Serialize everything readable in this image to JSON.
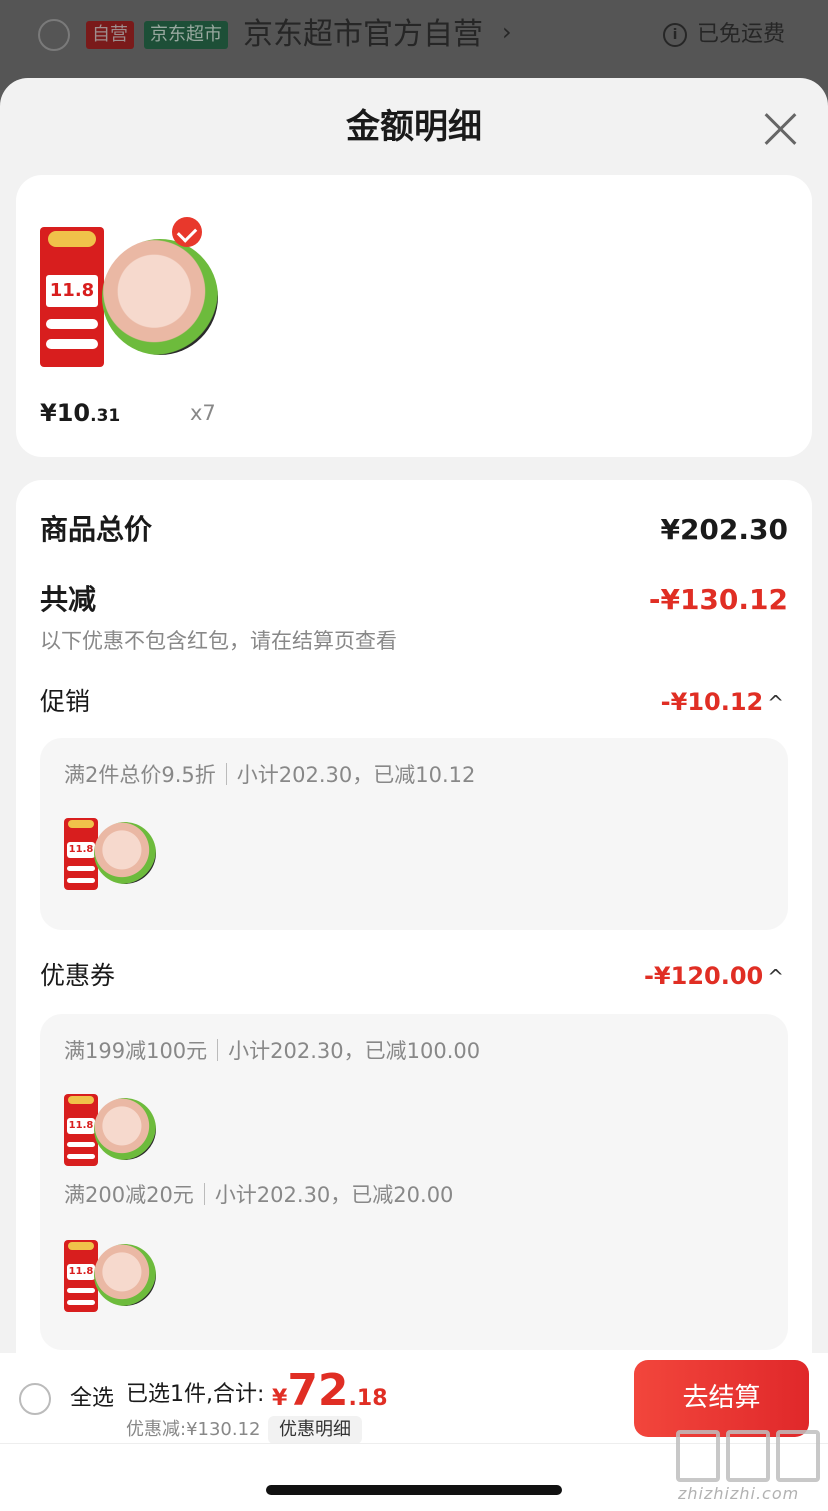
{
  "background_header": {
    "badge_self": "自营",
    "badge_mart": "京东超市",
    "store_name": "京东超市官方自营",
    "chevron": "›",
    "info_icon": "i",
    "shipping": "已免运费"
  },
  "sheet": {
    "title": "金额明细"
  },
  "product": {
    "banner_price": "11.8",
    "price_int": "¥10",
    "price_dec": ".31",
    "quantity": "x7",
    "selected": true
  },
  "summary": {
    "total_label": "商品总价",
    "total_value": "¥202.30",
    "discount_label": "共减",
    "discount_value": "-¥130.12",
    "note": "以下优惠不包含红包，请在结算页查看"
  },
  "promotion": {
    "label": "促销",
    "value": "-¥10.12",
    "caret": "^",
    "rule": "满2件总价9.5折",
    "detail": "小计202.30，已减10.12"
  },
  "coupon": {
    "label": "优惠券",
    "value": "-¥120.00",
    "caret": "^",
    "items": [
      {
        "rule": "满199减100元",
        "detail": "小计202.30，已减100.00"
      },
      {
        "rule": "满200减20元",
        "detail": "小计202.30，已减20.00"
      }
    ]
  },
  "bottom_bar": {
    "select_all": "全选",
    "selected_text": "已选1件,合计:",
    "total_symbol": "¥",
    "total_int": "72",
    "total_dec": ".18",
    "discount_text": "优惠减:¥130.12",
    "detail_button": "优惠明细",
    "checkout_button": "去结算"
  },
  "watermark": {
    "text": "zhizhizhi.com"
  },
  "colors": {
    "accent_red": "#e02e24",
    "sheet_bg": "#f2f2f2",
    "card_bg": "#ffffff"
  }
}
